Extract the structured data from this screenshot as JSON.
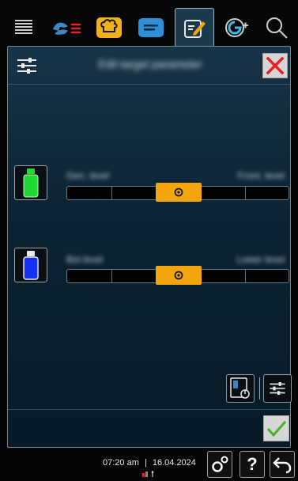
{
  "top_tabs": [
    {
      "icon": "list-icon",
      "active": false
    },
    {
      "icon": "hands-heat-icon",
      "active": false
    },
    {
      "icon": "chef-hat-icon",
      "active": false
    },
    {
      "icon": "message-icon",
      "active": false
    },
    {
      "icon": "edit-icon",
      "active": true
    },
    {
      "icon": "globe-plus-icon",
      "active": false
    },
    {
      "icon": "search-icon",
      "active": false
    }
  ],
  "panel": {
    "header_icon": "settings-sliders-icon",
    "title": "Edit target parameter",
    "close_icon": "close-icon"
  },
  "rows": [
    {
      "label_left": "Gen. level",
      "label_right": "Front. level",
      "bottle_color": "#1fd832",
      "bottle_icon": "green-bottle-icon",
      "slider_position_pct": 50
    },
    {
      "label_left": "Bot level",
      "label_right": "Lower level",
      "bottle_color": "#1431f2",
      "bottle_icon": "blue-bottle-icon",
      "slider_position_pct": 50
    }
  ],
  "colors": {
    "accent": "#f2a60c",
    "close": "#e8202a",
    "confirm": "#4caf2c"
  },
  "footer": {
    "time": "07:20 am",
    "separator": "|",
    "date": "16.04.2024"
  }
}
